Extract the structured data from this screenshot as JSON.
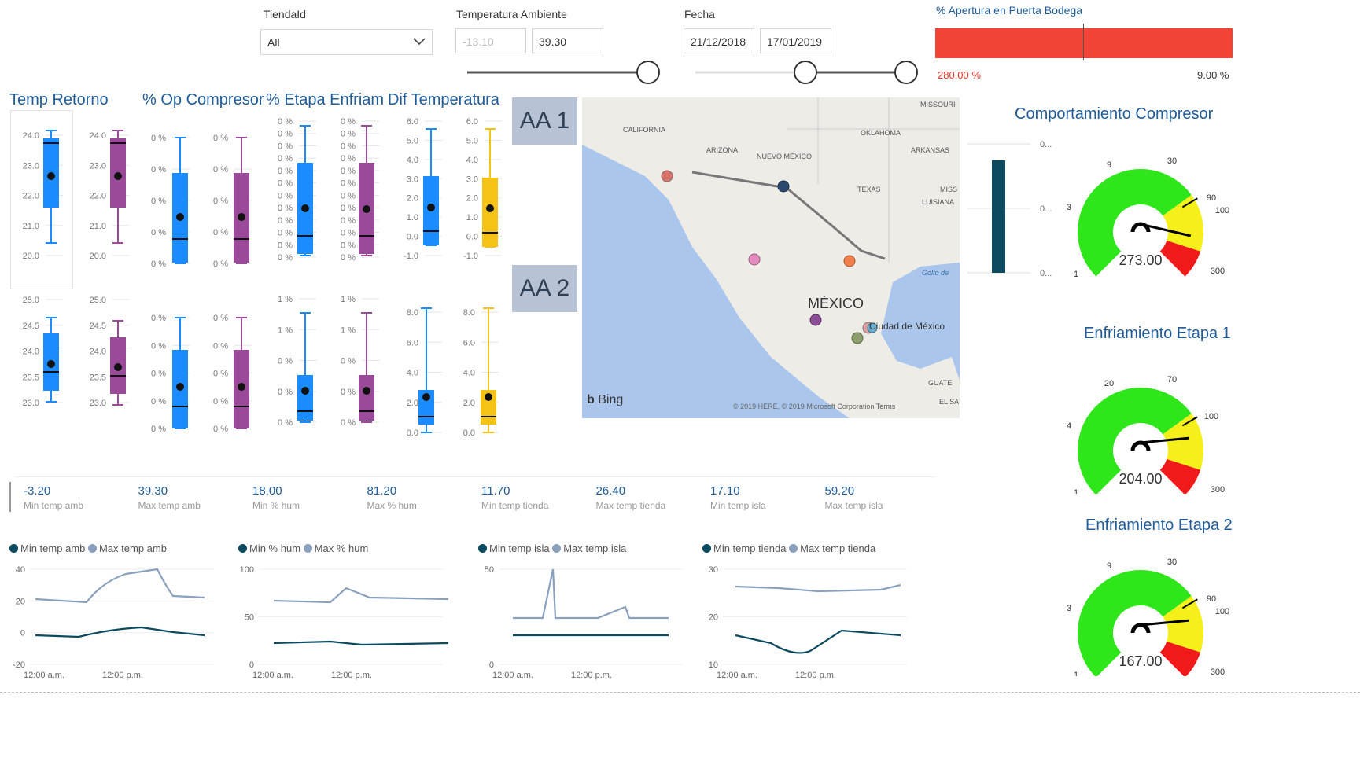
{
  "filters": {
    "tienda": {
      "label": "TiendaId",
      "value": "All"
    },
    "temp": {
      "label": "Temperatura Ambiente",
      "min": "-13.10",
      "max": "39.30"
    },
    "fecha": {
      "label": "Fecha",
      "start": "21/12/2018",
      "end": "17/01/2019"
    }
  },
  "puerta": {
    "title": "% Apertura en Puerta Bodega",
    "value_label": "280.00 %",
    "target_label": "9.00 %",
    "bar_color": "#f14436"
  },
  "boxplot_titles": [
    "Temp Retorno",
    "% Op Compresor",
    "% Etapa Enfriam",
    "Dif Temperatura"
  ],
  "aa": [
    "AA 1",
    "AA 2"
  ],
  "axes": {
    "retorno1": [
      "24.0",
      "23.0",
      "22.0",
      "21.0",
      "20.0"
    ],
    "retorno2": [
      "25.0",
      "24.5",
      "24.0",
      "23.5",
      "23.0"
    ],
    "comp1": [
      "0 %",
      "0 %",
      "0 %",
      "0 %",
      "0 %"
    ],
    "comp2": [
      "0 %",
      "0 %",
      "0 %",
      "0 %",
      "0 %"
    ],
    "etapa1": [
      "0 %",
      "0 %",
      "0 %",
      "0 %",
      "0 %",
      "0 %",
      "0 %",
      "0 %",
      "0 %",
      "0 %",
      "0 %",
      "0 %"
    ],
    "etapa2": [
      "1 %",
      "1 %",
      "0 %",
      "0 %",
      "0 %"
    ],
    "dif1": [
      "6.0",
      "5.0",
      "4.0",
      "3.0",
      "2.0",
      "1.0",
      "0.0",
      "-1.0"
    ],
    "dif2": [
      "8.0",
      "6.0",
      "4.0",
      "2.0",
      "0.0"
    ]
  },
  "map": {
    "labels": {
      "ca": "CALIFORNIA",
      "az": "ARIZONA",
      "nm": "NUEVO MÉXICO",
      "ok": "OKLAHOMA",
      "ar": "ARKANSAS",
      "tx": "TEXAS",
      "mo": "MISSOURI",
      "ms": "MISS",
      "la": "LUISIANA",
      "mx": "MÉXICO",
      "cdmx": "Ciudad de México",
      "golfo": "Golfo de",
      "guat": "GUATE",
      "elsa": "EL SA"
    },
    "bing": "Bing",
    "copyright": "© 2019 HERE, © 2019 Microsoft Corporation",
    "terms": "Terms"
  },
  "kpis": [
    {
      "value": "-3.20",
      "label": "Min temp amb"
    },
    {
      "value": "39.30",
      "label": "Max temp amb"
    },
    {
      "value": "18.00",
      "label": "Min % hum"
    },
    {
      "value": "81.20",
      "label": "Max % hum"
    },
    {
      "value": "11.70",
      "label": "Min temp tienda"
    },
    {
      "value": "26.40",
      "label": "Max temp tienda"
    },
    {
      "value": "17.10",
      "label": "Min temp isla"
    },
    {
      "value": "59.20",
      "label": "Max temp isla"
    }
  ],
  "line_charts": [
    {
      "legend": [
        "Min temp amb",
        "Max temp amb"
      ],
      "yticks": [
        "40",
        "20",
        "0",
        "-20"
      ],
      "xticks": [
        "12:00 a.m.",
        "12:00 p.m."
      ]
    },
    {
      "legend": [
        "Min % hum",
        "Max % hum"
      ],
      "yticks": [
        "100",
        "50",
        "0"
      ],
      "xticks": [
        "12:00 a.m.",
        "12:00 p.m."
      ]
    },
    {
      "legend": [
        "Min temp isla",
        "Max temp isla"
      ],
      "yticks": [
        "50",
        "0"
      ],
      "xticks": [
        "12:00 a.m.",
        "12:00 p.m."
      ]
    },
    {
      "legend": [
        "Min temp tienda",
        "Max temp tienda"
      ],
      "yticks": [
        "30",
        "20",
        "10"
      ],
      "xticks": [
        "12:00 a.m.",
        "12:00 p.m."
      ]
    }
  ],
  "series_colors": {
    "min": "#0c4a60",
    "max": "#8aa0bd"
  },
  "compresor": {
    "title": "Comportamiento Compresor",
    "axis": [
      "0...",
      "0...",
      "0..."
    ]
  },
  "gauges": [
    {
      "title": "",
      "value": "273.00",
      "ticks": {
        "min": "1",
        "a": "3",
        "b": "9",
        "c": "30",
        "d": "90",
        "e": "100",
        "max": "300"
      }
    },
    {
      "title": "Enfriamiento Etapa 1",
      "value": "204.00",
      "ticks": {
        "min": "1",
        "a": "4",
        "b": "20",
        "c": "70",
        "d": "100",
        "max": "300"
      }
    },
    {
      "title": "Enfriamiento Etapa 2",
      "value": "167.00",
      "ticks": {
        "min": "1",
        "a": "3",
        "b": "9",
        "c": "30",
        "d": "90",
        "e": "100",
        "max": "300"
      }
    }
  ]
}
